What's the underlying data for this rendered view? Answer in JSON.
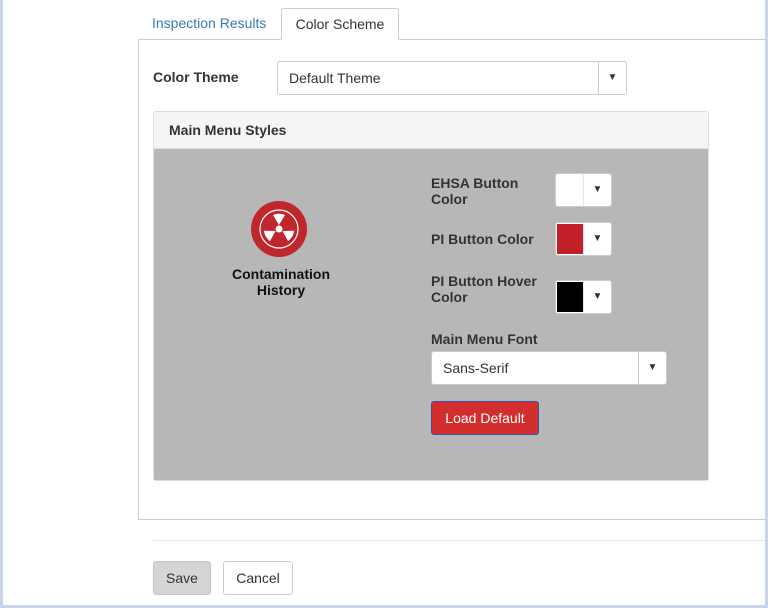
{
  "tabs": [
    {
      "label": "Inspection Results",
      "active": false
    },
    {
      "label": "Color Scheme",
      "active": true
    }
  ],
  "color_theme": {
    "label": "Color Theme",
    "selected": "Default Theme"
  },
  "panel": {
    "heading": "Main Menu Styles",
    "preview": {
      "icon": "radiation-hazard-icon",
      "label": "Contamination History"
    },
    "ehsa_button_color": {
      "label": "EHSA Button Color",
      "value": "#ffffff"
    },
    "pi_button_color": {
      "label": "PI Button Color",
      "value": "#c1202a"
    },
    "pi_button_hover_color": {
      "label": "PI Button Hover Color",
      "value": "#000000"
    },
    "main_menu_font": {
      "label": "Main Menu Font",
      "selected": "Sans-Serif"
    },
    "load_default_label": "Load Default"
  },
  "footer": {
    "save_label": "Save",
    "cancel_label": "Cancel"
  },
  "colors": {
    "link": "#337ab7",
    "panel_body_bg": "#b7b7b7",
    "load_default_bg": "#d22e2e",
    "preview_icon_bg": "#c0272d"
  }
}
